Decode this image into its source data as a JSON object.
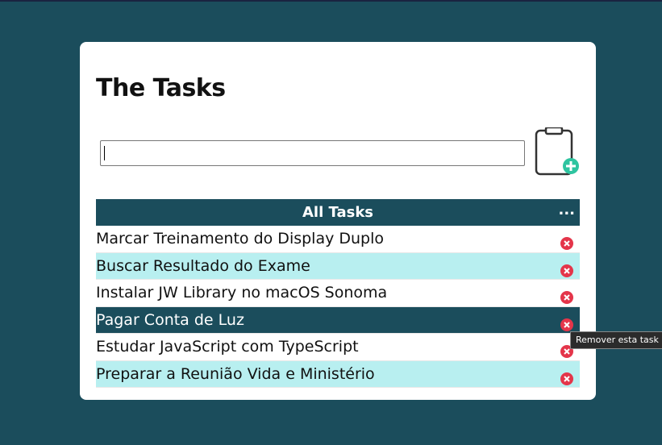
{
  "app": {
    "title": "The Tasks"
  },
  "input": {
    "value": "",
    "placeholder": ""
  },
  "add_button": {
    "icon": "clipboard-plus-icon"
  },
  "list": {
    "header": "All Tasks",
    "more_label": "...",
    "items": [
      {
        "label": "Marcar Treinamento do Display Duplo",
        "style": "plain"
      },
      {
        "label": "Buscar Resultado do Exame",
        "style": "alt"
      },
      {
        "label": "Instalar JW Library no macOS Sonoma",
        "style": "plain"
      },
      {
        "label": "Pagar Conta de Luz",
        "style": "hover"
      },
      {
        "label": "Estudar JavaScript com TypeScript",
        "style": "plain"
      },
      {
        "label": "Preparar a Reunião Vida e Ministério",
        "style": "alt"
      }
    ]
  },
  "tooltip": {
    "text": "Remover esta task"
  },
  "colors": {
    "brand": "#1b4d5c",
    "alt_row": "#b8eff0",
    "remove": "#e4354a",
    "add": "#2ec4a0"
  }
}
